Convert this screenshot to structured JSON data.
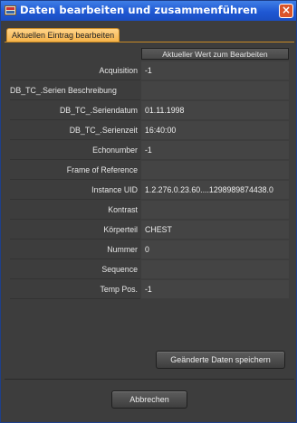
{
  "window": {
    "title": "Daten bearbeiten und zusammenführen",
    "close_label": "×"
  },
  "tabs": [
    {
      "label": "Aktuellen Eintrag bearbeiten",
      "active": true
    }
  ],
  "table": {
    "column_header": "Aktueller Wert zum Bearbeiten",
    "rows": [
      {
        "label": "Acquisition",
        "value": "-1"
      },
      {
        "label": "DB_TC_.Serien Beschreibung",
        "value": ""
      },
      {
        "label": "DB_TC_.Seriendatum",
        "value": "01.11.1998"
      },
      {
        "label": "DB_TC_.Serienzeit",
        "value": "16:40:00"
      },
      {
        "label": "Echonumber",
        "value": "-1"
      },
      {
        "label": "Frame of Reference",
        "value": ""
      },
      {
        "label": "Instance UID",
        "value": "1.2.276.0.23.60....1298989874438.0"
      },
      {
        "label": "Kontrast",
        "value": ""
      },
      {
        "label": "Körperteil",
        "value": "CHEST"
      },
      {
        "label": "Nummer",
        "value": "0"
      },
      {
        "label": "Sequence",
        "value": ""
      },
      {
        "label": "Temp Pos.",
        "value": "-1"
      }
    ]
  },
  "buttons": {
    "save": "Geänderte Daten speichern",
    "cancel": "Abbrechen"
  },
  "colors": {
    "titlebar": "#1f58d3",
    "tab_active": "#f6b44b",
    "background": "#3d3d3d"
  }
}
